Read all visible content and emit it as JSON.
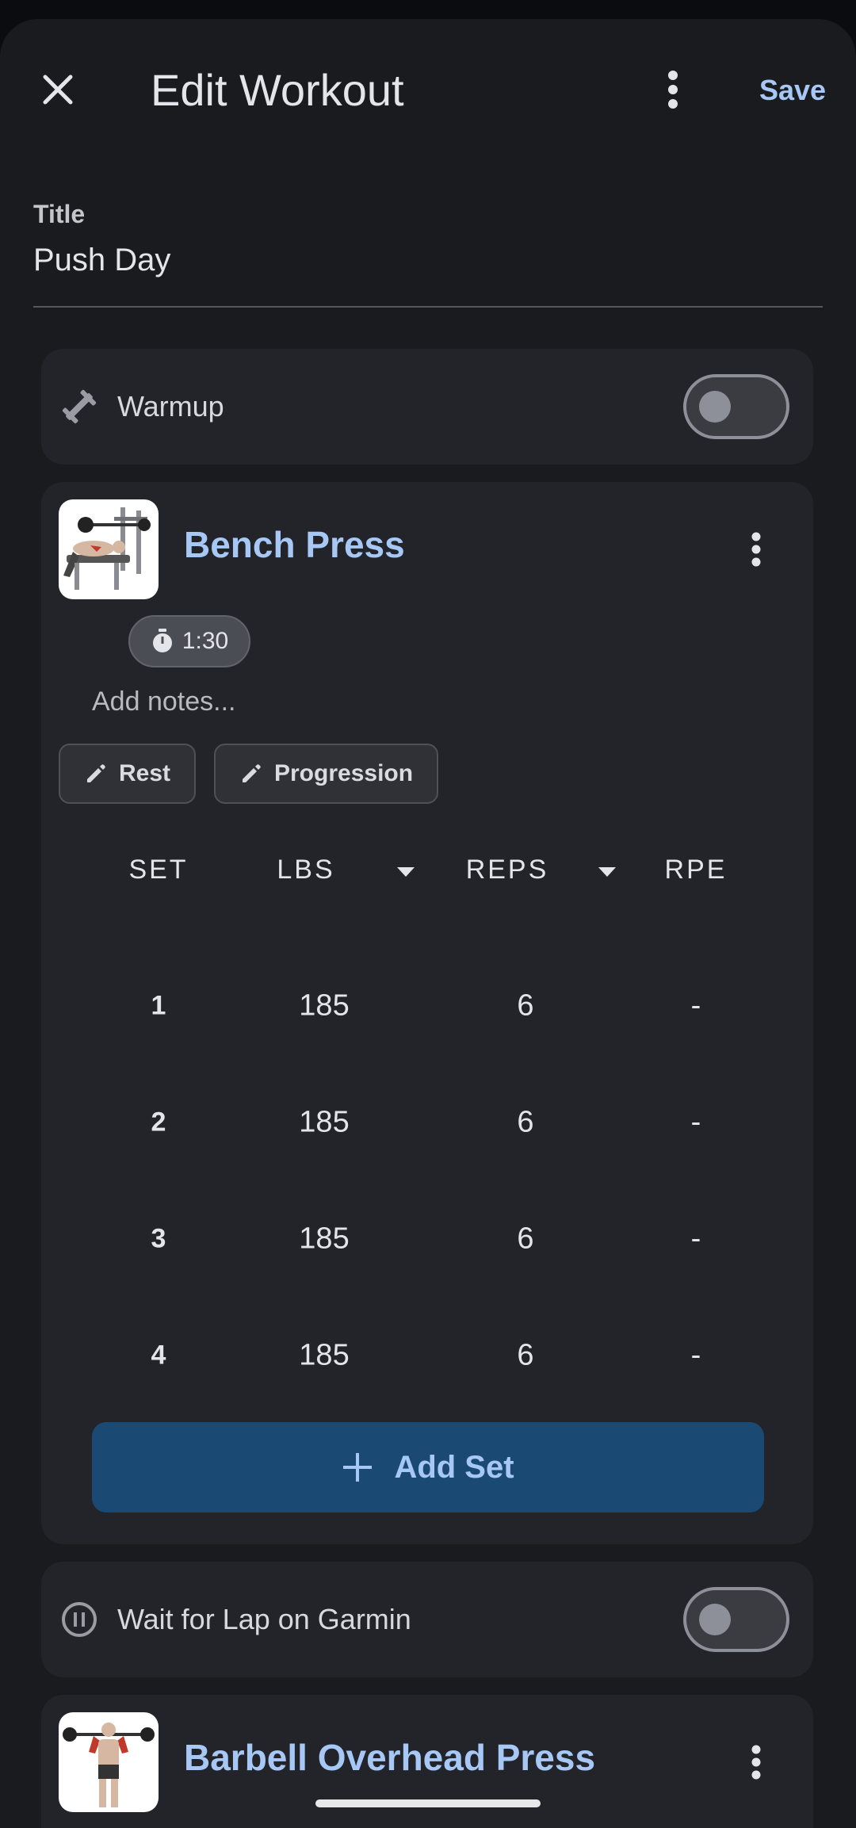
{
  "header": {
    "title": "Edit Workout",
    "save_label": "Save"
  },
  "title_field": {
    "label": "Title",
    "value": "Push Day"
  },
  "warmup": {
    "label": "Warmup",
    "enabled": false
  },
  "exercises": [
    {
      "name": "Bench Press",
      "rest_timer": "1:30",
      "notes_placeholder": "Add notes...",
      "chips": [
        "Rest",
        "Progression"
      ],
      "columns": [
        "SET",
        "LBS",
        "REPS",
        "RPE"
      ],
      "sets": [
        {
          "set": "1",
          "lbs": "185",
          "reps": "6",
          "rpe": "-"
        },
        {
          "set": "2",
          "lbs": "185",
          "reps": "6",
          "rpe": "-"
        },
        {
          "set": "3",
          "lbs": "185",
          "reps": "6",
          "rpe": "-"
        },
        {
          "set": "4",
          "lbs": "185",
          "reps": "6",
          "rpe": "-"
        }
      ],
      "add_set_label": "Add Set"
    },
    {
      "name": "Barbell Overhead Press"
    }
  ],
  "garmin": {
    "label": "Wait for Lap on Garmin",
    "enabled": false
  },
  "colors": {
    "accent": "#a7c8f5",
    "add_set_bg": "#1a4a74",
    "card_bg": "#232429",
    "sheet_bg": "#1a1b1f"
  }
}
